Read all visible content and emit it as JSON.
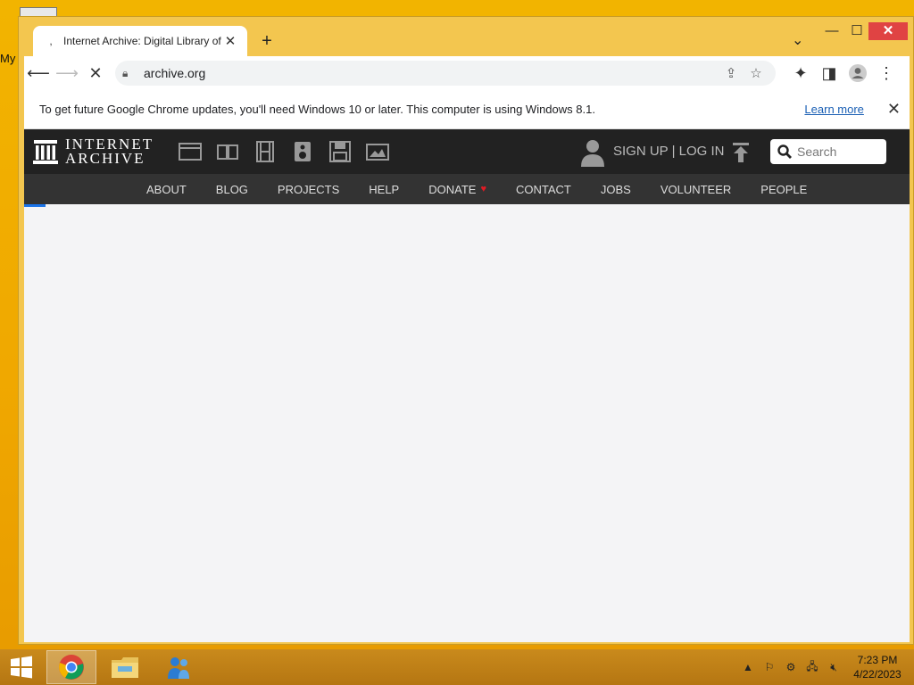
{
  "desktop": {
    "icon_label": "My"
  },
  "browser": {
    "tab_title": "Internet Archive: Digital Library of Free & Borrowable Books, Movies, Music & Wayback Machine",
    "new_tab_symbol": "+",
    "url": "archive.org",
    "infobar": {
      "message": "To get future Google Chrome updates, you'll need Windows 10 or later. This computer is using Windows 8.1.",
      "link": "Learn more"
    }
  },
  "ia": {
    "logo_line1": "INTERNET",
    "logo_line2": "ARCHIVE",
    "media_icons": [
      "web-icon",
      "book-icon",
      "film-icon",
      "audio-icon",
      "software-icon",
      "images-icon"
    ],
    "signup": "SIGN UP | LOG IN",
    "search_placeholder": "Search",
    "nav": [
      "ABOUT",
      "BLOG",
      "PROJECTS",
      "HELP",
      "DONATE",
      "CONTACT",
      "JOBS",
      "VOLUNTEER",
      "PEOPLE"
    ],
    "heart_color": "#e01b24"
  },
  "taskbar": {
    "time": "7:23 PM",
    "date": "4/22/2023"
  },
  "colors": {
    "accent": "#1a73e8",
    "desktop": "#f0a800",
    "ia_header": "#222222"
  }
}
